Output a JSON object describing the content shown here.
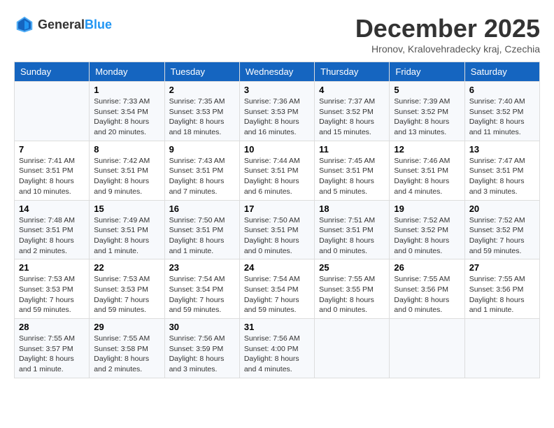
{
  "logo": {
    "text_general": "General",
    "text_blue": "Blue"
  },
  "title": "December 2025",
  "location": "Hronov, Kralovehradecky kraj, Czechia",
  "headers": [
    "Sunday",
    "Monday",
    "Tuesday",
    "Wednesday",
    "Thursday",
    "Friday",
    "Saturday"
  ],
  "weeks": [
    [
      {
        "day": "",
        "info": ""
      },
      {
        "day": "1",
        "info": "Sunrise: 7:33 AM\nSunset: 3:54 PM\nDaylight: 8 hours\nand 20 minutes."
      },
      {
        "day": "2",
        "info": "Sunrise: 7:35 AM\nSunset: 3:53 PM\nDaylight: 8 hours\nand 18 minutes."
      },
      {
        "day": "3",
        "info": "Sunrise: 7:36 AM\nSunset: 3:53 PM\nDaylight: 8 hours\nand 16 minutes."
      },
      {
        "day": "4",
        "info": "Sunrise: 7:37 AM\nSunset: 3:52 PM\nDaylight: 8 hours\nand 15 minutes."
      },
      {
        "day": "5",
        "info": "Sunrise: 7:39 AM\nSunset: 3:52 PM\nDaylight: 8 hours\nand 13 minutes."
      },
      {
        "day": "6",
        "info": "Sunrise: 7:40 AM\nSunset: 3:52 PM\nDaylight: 8 hours\nand 11 minutes."
      }
    ],
    [
      {
        "day": "7",
        "info": "Sunrise: 7:41 AM\nSunset: 3:51 PM\nDaylight: 8 hours\nand 10 minutes."
      },
      {
        "day": "8",
        "info": "Sunrise: 7:42 AM\nSunset: 3:51 PM\nDaylight: 8 hours\nand 9 minutes."
      },
      {
        "day": "9",
        "info": "Sunrise: 7:43 AM\nSunset: 3:51 PM\nDaylight: 8 hours\nand 7 minutes."
      },
      {
        "day": "10",
        "info": "Sunrise: 7:44 AM\nSunset: 3:51 PM\nDaylight: 8 hours\nand 6 minutes."
      },
      {
        "day": "11",
        "info": "Sunrise: 7:45 AM\nSunset: 3:51 PM\nDaylight: 8 hours\nand 5 minutes."
      },
      {
        "day": "12",
        "info": "Sunrise: 7:46 AM\nSunset: 3:51 PM\nDaylight: 8 hours\nand 4 minutes."
      },
      {
        "day": "13",
        "info": "Sunrise: 7:47 AM\nSunset: 3:51 PM\nDaylight: 8 hours\nand 3 minutes."
      }
    ],
    [
      {
        "day": "14",
        "info": "Sunrise: 7:48 AM\nSunset: 3:51 PM\nDaylight: 8 hours\nand 2 minutes."
      },
      {
        "day": "15",
        "info": "Sunrise: 7:49 AM\nSunset: 3:51 PM\nDaylight: 8 hours\nand 1 minute."
      },
      {
        "day": "16",
        "info": "Sunrise: 7:50 AM\nSunset: 3:51 PM\nDaylight: 8 hours\nand 1 minute."
      },
      {
        "day": "17",
        "info": "Sunrise: 7:50 AM\nSunset: 3:51 PM\nDaylight: 8 hours\nand 0 minutes."
      },
      {
        "day": "18",
        "info": "Sunrise: 7:51 AM\nSunset: 3:51 PM\nDaylight: 8 hours\nand 0 minutes."
      },
      {
        "day": "19",
        "info": "Sunrise: 7:52 AM\nSunset: 3:52 PM\nDaylight: 8 hours\nand 0 minutes."
      },
      {
        "day": "20",
        "info": "Sunrise: 7:52 AM\nSunset: 3:52 PM\nDaylight: 7 hours\nand 59 minutes."
      }
    ],
    [
      {
        "day": "21",
        "info": "Sunrise: 7:53 AM\nSunset: 3:53 PM\nDaylight: 7 hours\nand 59 minutes."
      },
      {
        "day": "22",
        "info": "Sunrise: 7:53 AM\nSunset: 3:53 PM\nDaylight: 7 hours\nand 59 minutes."
      },
      {
        "day": "23",
        "info": "Sunrise: 7:54 AM\nSunset: 3:54 PM\nDaylight: 7 hours\nand 59 minutes."
      },
      {
        "day": "24",
        "info": "Sunrise: 7:54 AM\nSunset: 3:54 PM\nDaylight: 7 hours\nand 59 minutes."
      },
      {
        "day": "25",
        "info": "Sunrise: 7:55 AM\nSunset: 3:55 PM\nDaylight: 8 hours\nand 0 minutes."
      },
      {
        "day": "26",
        "info": "Sunrise: 7:55 AM\nSunset: 3:56 PM\nDaylight: 8 hours\nand 0 minutes."
      },
      {
        "day": "27",
        "info": "Sunrise: 7:55 AM\nSunset: 3:56 PM\nDaylight: 8 hours\nand 1 minute."
      }
    ],
    [
      {
        "day": "28",
        "info": "Sunrise: 7:55 AM\nSunset: 3:57 PM\nDaylight: 8 hours\nand 1 minute."
      },
      {
        "day": "29",
        "info": "Sunrise: 7:55 AM\nSunset: 3:58 PM\nDaylight: 8 hours\nand 2 minutes."
      },
      {
        "day": "30",
        "info": "Sunrise: 7:56 AM\nSunset: 3:59 PM\nDaylight: 8 hours\nand 3 minutes."
      },
      {
        "day": "31",
        "info": "Sunrise: 7:56 AM\nSunset: 4:00 PM\nDaylight: 8 hours\nand 4 minutes."
      },
      {
        "day": "",
        "info": ""
      },
      {
        "day": "",
        "info": ""
      },
      {
        "day": "",
        "info": ""
      }
    ]
  ]
}
